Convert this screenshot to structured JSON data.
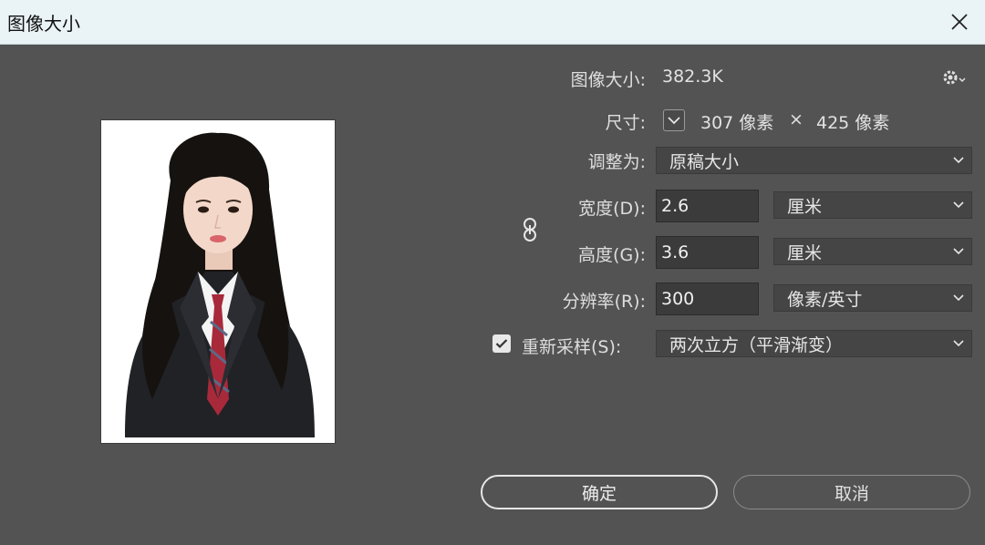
{
  "window": {
    "title": "图像大小"
  },
  "info": {
    "image_size_label": "图像大小:",
    "image_size_value": "382.3K",
    "dimensions_label": "尺寸:",
    "width_px": "307 像素",
    "times": "×",
    "height_px": "425 像素"
  },
  "fit_to": {
    "label": "调整为:",
    "value": "原稿大小"
  },
  "width": {
    "label": "宽度(D):",
    "value": "2.6",
    "unit": "厘米"
  },
  "height": {
    "label": "高度(G):",
    "value": "3.6",
    "unit": "厘米"
  },
  "resolution": {
    "label": "分辨率(R):",
    "value": "300",
    "unit": "像素/英寸"
  },
  "resample": {
    "label": "重新采样(S):",
    "checked": true,
    "method": "两次立方（平滑渐变）"
  },
  "buttons": {
    "ok": "确定",
    "cancel": "取消"
  },
  "icons": [
    "close-icon",
    "gear-icon",
    "chevron-down-icon",
    "link-icon",
    "checkmark-icon"
  ]
}
